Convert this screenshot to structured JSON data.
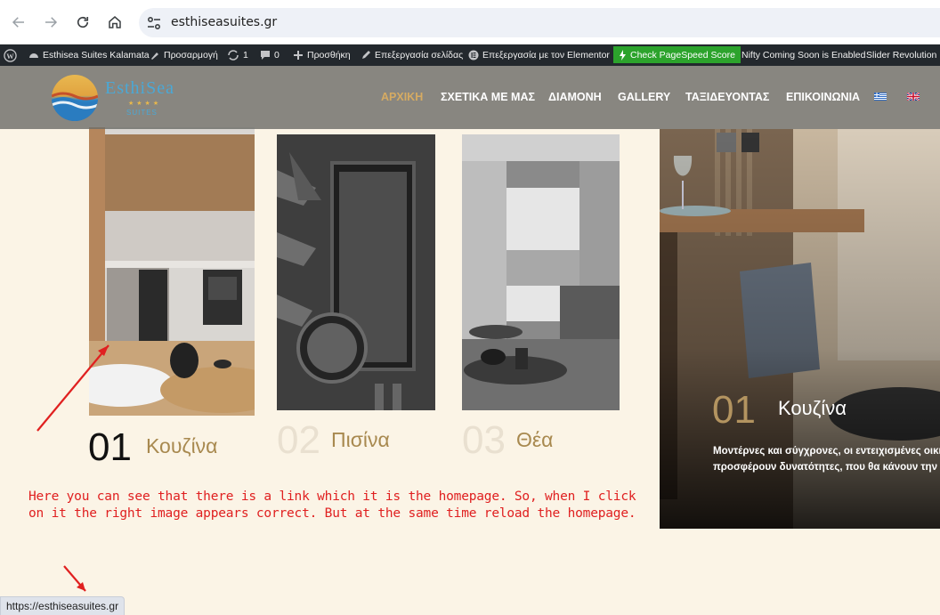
{
  "browser": {
    "url": "esthiseasuites.gr"
  },
  "admin_bar": {
    "site_name": "Esthisea Suites Kalamata",
    "customize": "Προσαρμογή",
    "updates_count": "1",
    "comments_count": "0",
    "add_new": "Προσθήκη",
    "edit_page": "Επεξεργασία σελίδας",
    "edit_elementor": "Επεξεργασία με τον Elementor",
    "pagespeed": "Check PageSpeed Score",
    "nifty": "Nifty Coming Soon is Enabled",
    "slider_rev": "Slider Revolution"
  },
  "header": {
    "logo_text": "EsthiSea",
    "logo_stars": "★★★★",
    "logo_sub": "SUITES",
    "menu": [
      {
        "label": "ΑΡΧΙΚΗ"
      },
      {
        "label": "ΣΧΕΤΙΚΑ ΜΕ ΜΑΣ"
      },
      {
        "label": "ΔΙΑΜΟΝΗ"
      },
      {
        "label": "GALLERY"
      },
      {
        "label": "ΤΑΞΙΔΕΥΟΝΤΑΣ"
      },
      {
        "label": "ΕΠΙΚΟΙΝΩΝΙΑ"
      }
    ]
  },
  "cards": [
    {
      "num": "01",
      "title": "Κουζίνα"
    },
    {
      "num": "02",
      "title": "Πισίνα"
    },
    {
      "num": "03",
      "title": "Θέα"
    }
  ],
  "note": "Here you can see that there is a link which it is the homepage. So, when I click on it the right image appears correct. But at the same time reload the homepage.",
  "slider": {
    "num": "01",
    "title": "Κουζίνα",
    "desc_line1": "Μοντέρνες και σύγχρονες, οι εντειχισμένες οικιακ",
    "desc_line2": "προσφέρουν δυνατότητες, που θα κάνουν την δ"
  },
  "status_bar": {
    "url": "https://esthiseasuites.gr"
  },
  "colors": {
    "accent": "#d6ab62",
    "annotation": "#e02020",
    "pagespeed": "#2ca32c"
  }
}
